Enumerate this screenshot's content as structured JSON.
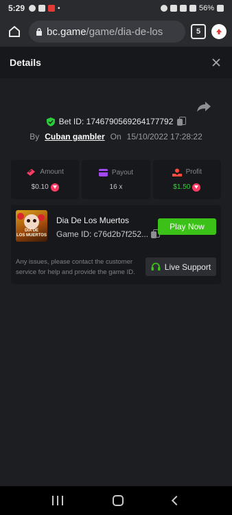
{
  "status_bar": {
    "time": "5:29",
    "battery": "56%"
  },
  "browser": {
    "url_domain": "bc.game",
    "url_path": "/game/dia-de-los",
    "tab_count": "5"
  },
  "header": {
    "title": "Details"
  },
  "bet": {
    "id_label": "Bet ID: 1746790569264177792",
    "by_label": "By",
    "user": "Cuban gambler",
    "on_label": "On",
    "datetime": "15/10/2022 17:28:22"
  },
  "stats": {
    "amount_label": "Amount",
    "amount_value": "$0.10",
    "payout_label": "Payout",
    "payout_value": "16 x",
    "profit_label": "Profit",
    "profit_value": "$1.50"
  },
  "game": {
    "name": "Dia De Los Muertos",
    "id": "Game ID: c76d2b7f252...",
    "thumb_line1": "DIA DE",
    "thumb_line2": "LOS MUERTOS",
    "play_label": "Play Now",
    "note": "Any issues, please contact the customer service for help and provide the game ID.",
    "support_label": "Live Support"
  },
  "colors": {
    "accent_green": "#3bc117",
    "profit_green": "#38d13a",
    "coin_red": "#ff3d64"
  }
}
